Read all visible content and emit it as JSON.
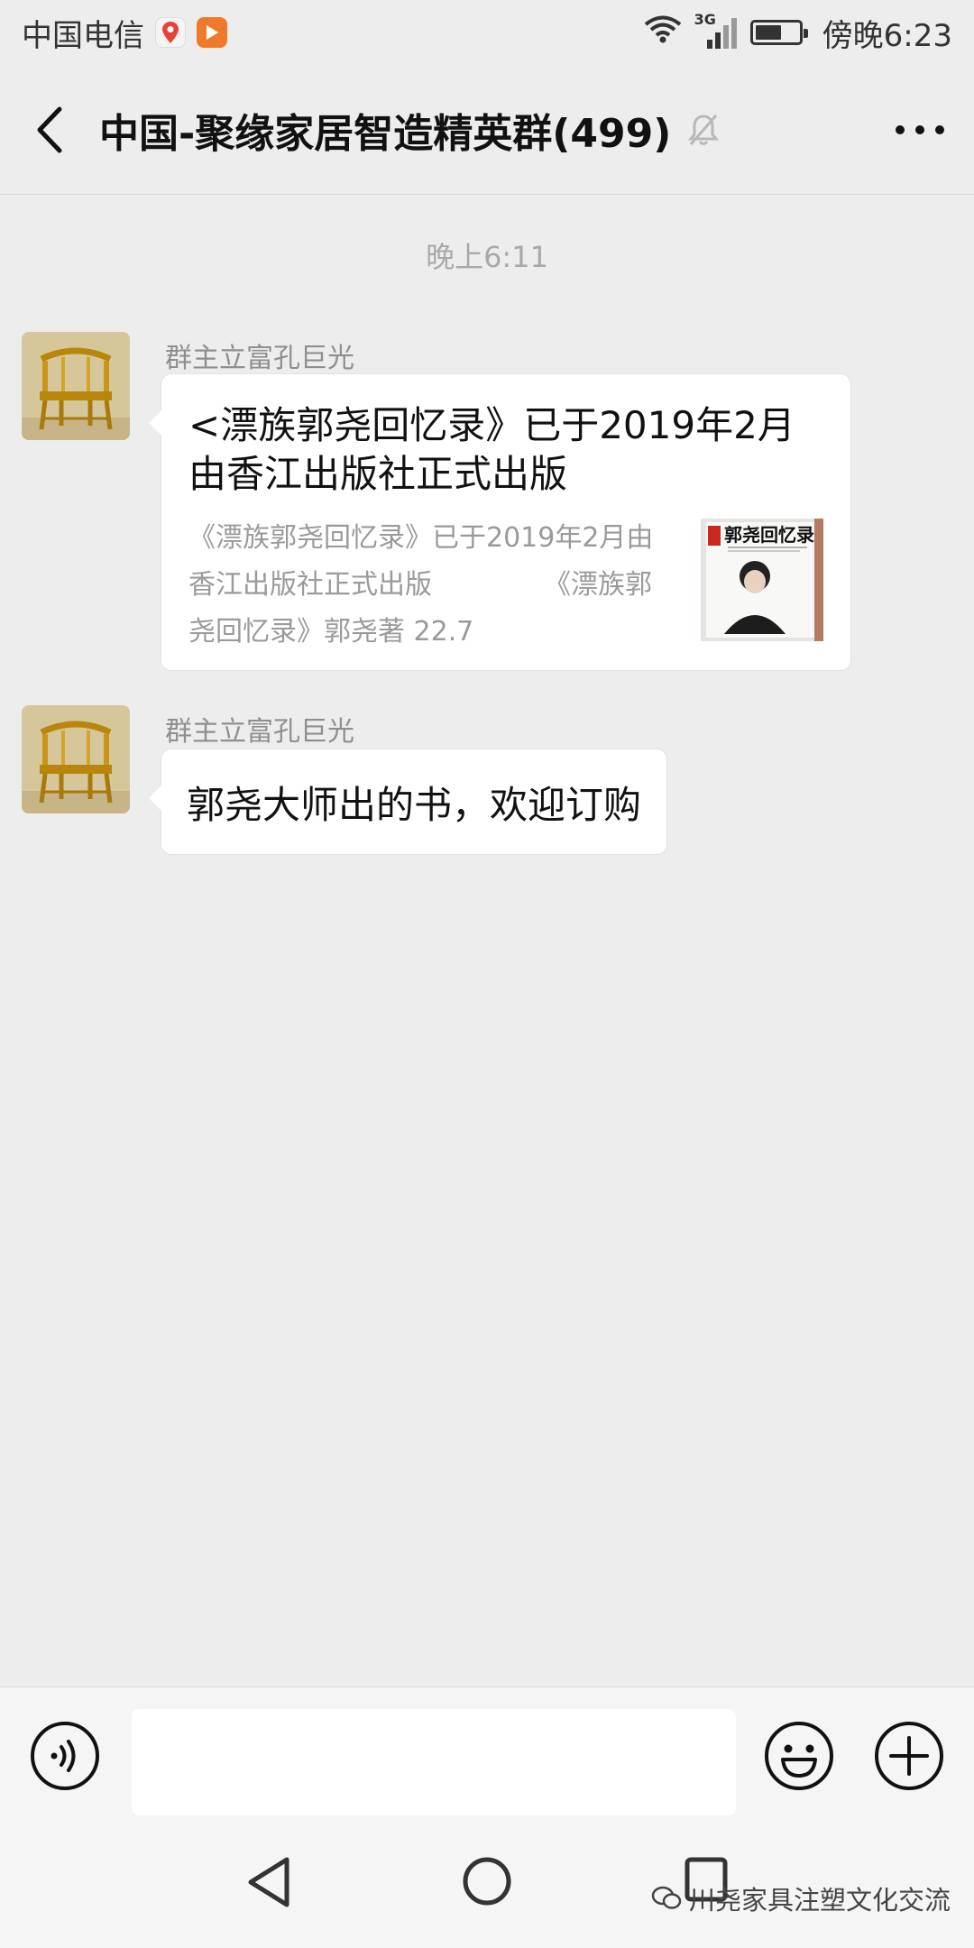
{
  "status_bar": {
    "carrier": "中国电信",
    "network_label": "3G",
    "time": "傍晚6:23"
  },
  "header": {
    "title": "中国-聚缘家居智造精英群(499)"
  },
  "chat": {
    "timestamp": "晚上6:11",
    "messages": [
      {
        "sender": "群主立富孔巨光",
        "link_title": "<漂族郭尧回忆录》已于2019年2月由香江出版社正式出版",
        "link_desc_line1": "《漂族郭尧回忆录》已于2019年2月由",
        "link_desc_line2a": "香江出版社正式出版",
        "link_desc_line2b": "《漂族郭",
        "link_desc_line3": "尧回忆录》郭尧著 22.7",
        "thumb_title": "郭尧回忆录"
      },
      {
        "sender": "群主立富孔巨光",
        "text": "郭尧大师出的书，欢迎订购"
      }
    ]
  },
  "input_bar": {
    "value": ""
  },
  "watermark": {
    "text": "川尧家具注塑文化交流"
  },
  "colors": {
    "background": "#ededed",
    "bubble": "#ffffff",
    "meta_text": "#a9a9a9"
  }
}
